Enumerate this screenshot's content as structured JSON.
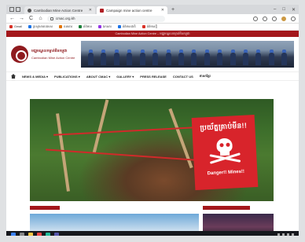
{
  "browser": {
    "tabs": [
      {
        "label": "Cambodian Mine Action Centre",
        "active": false
      },
      {
        "label": "Campaign mine action centre",
        "active": true
      }
    ],
    "new_tab": "+",
    "window_controls": [
      "–",
      "□",
      "✕"
    ],
    "address": "cmac.org.kh",
    "nav": {
      "back": "←",
      "forward": "→",
      "reload": "C",
      "home": "⌂"
    },
    "bookmarks": [
      {
        "label": "Gmail",
        "color": "#d93025"
      },
      {
        "label": "ក្រសួងការបរទេស",
        "color": "#1a73e8"
      },
      {
        "label": "ធនាគារ",
        "color": "#e37400"
      },
      {
        "label": "ព័ត៌មាន",
        "color": "#188038"
      },
      {
        "label": "ឯកសារ",
        "color": "#9334e6"
      },
      {
        "label": "ព័ត៌មានជាតិ",
        "color": "#1a73e8"
      },
      {
        "label": "ព័ត៌មានថ្មី",
        "color": "#d93025"
      }
    ]
  },
  "site": {
    "topstrip": "Cambodian Mine Action Centre – មជ្ឈមណ្ឌលកម្ចាត់មីនកម្ពុជា",
    "logo_km": "មជ្ឈមណ្ឌលកម្ចាត់មីនកម្ពុជា",
    "logo_en": "Cambodian Mine Action Centre",
    "menu": [
      "NEWS & MEDIA ▾",
      "PUBLICATIONS ▾",
      "ABOUT CMAC ▾",
      "GALLERY ▾",
      "PRESS RELEASE",
      "CONTACT US",
      "ភាសាខ្មែរ"
    ],
    "hero": {
      "sign_km": "ប្រយ័ត្នគ្រាប់មីន!!",
      "sign_en": "Danger!! Mines!!"
    },
    "sections": [
      "",
      ""
    ]
  },
  "colors": {
    "brand": "#a3171b",
    "sign": "#d8242b"
  }
}
